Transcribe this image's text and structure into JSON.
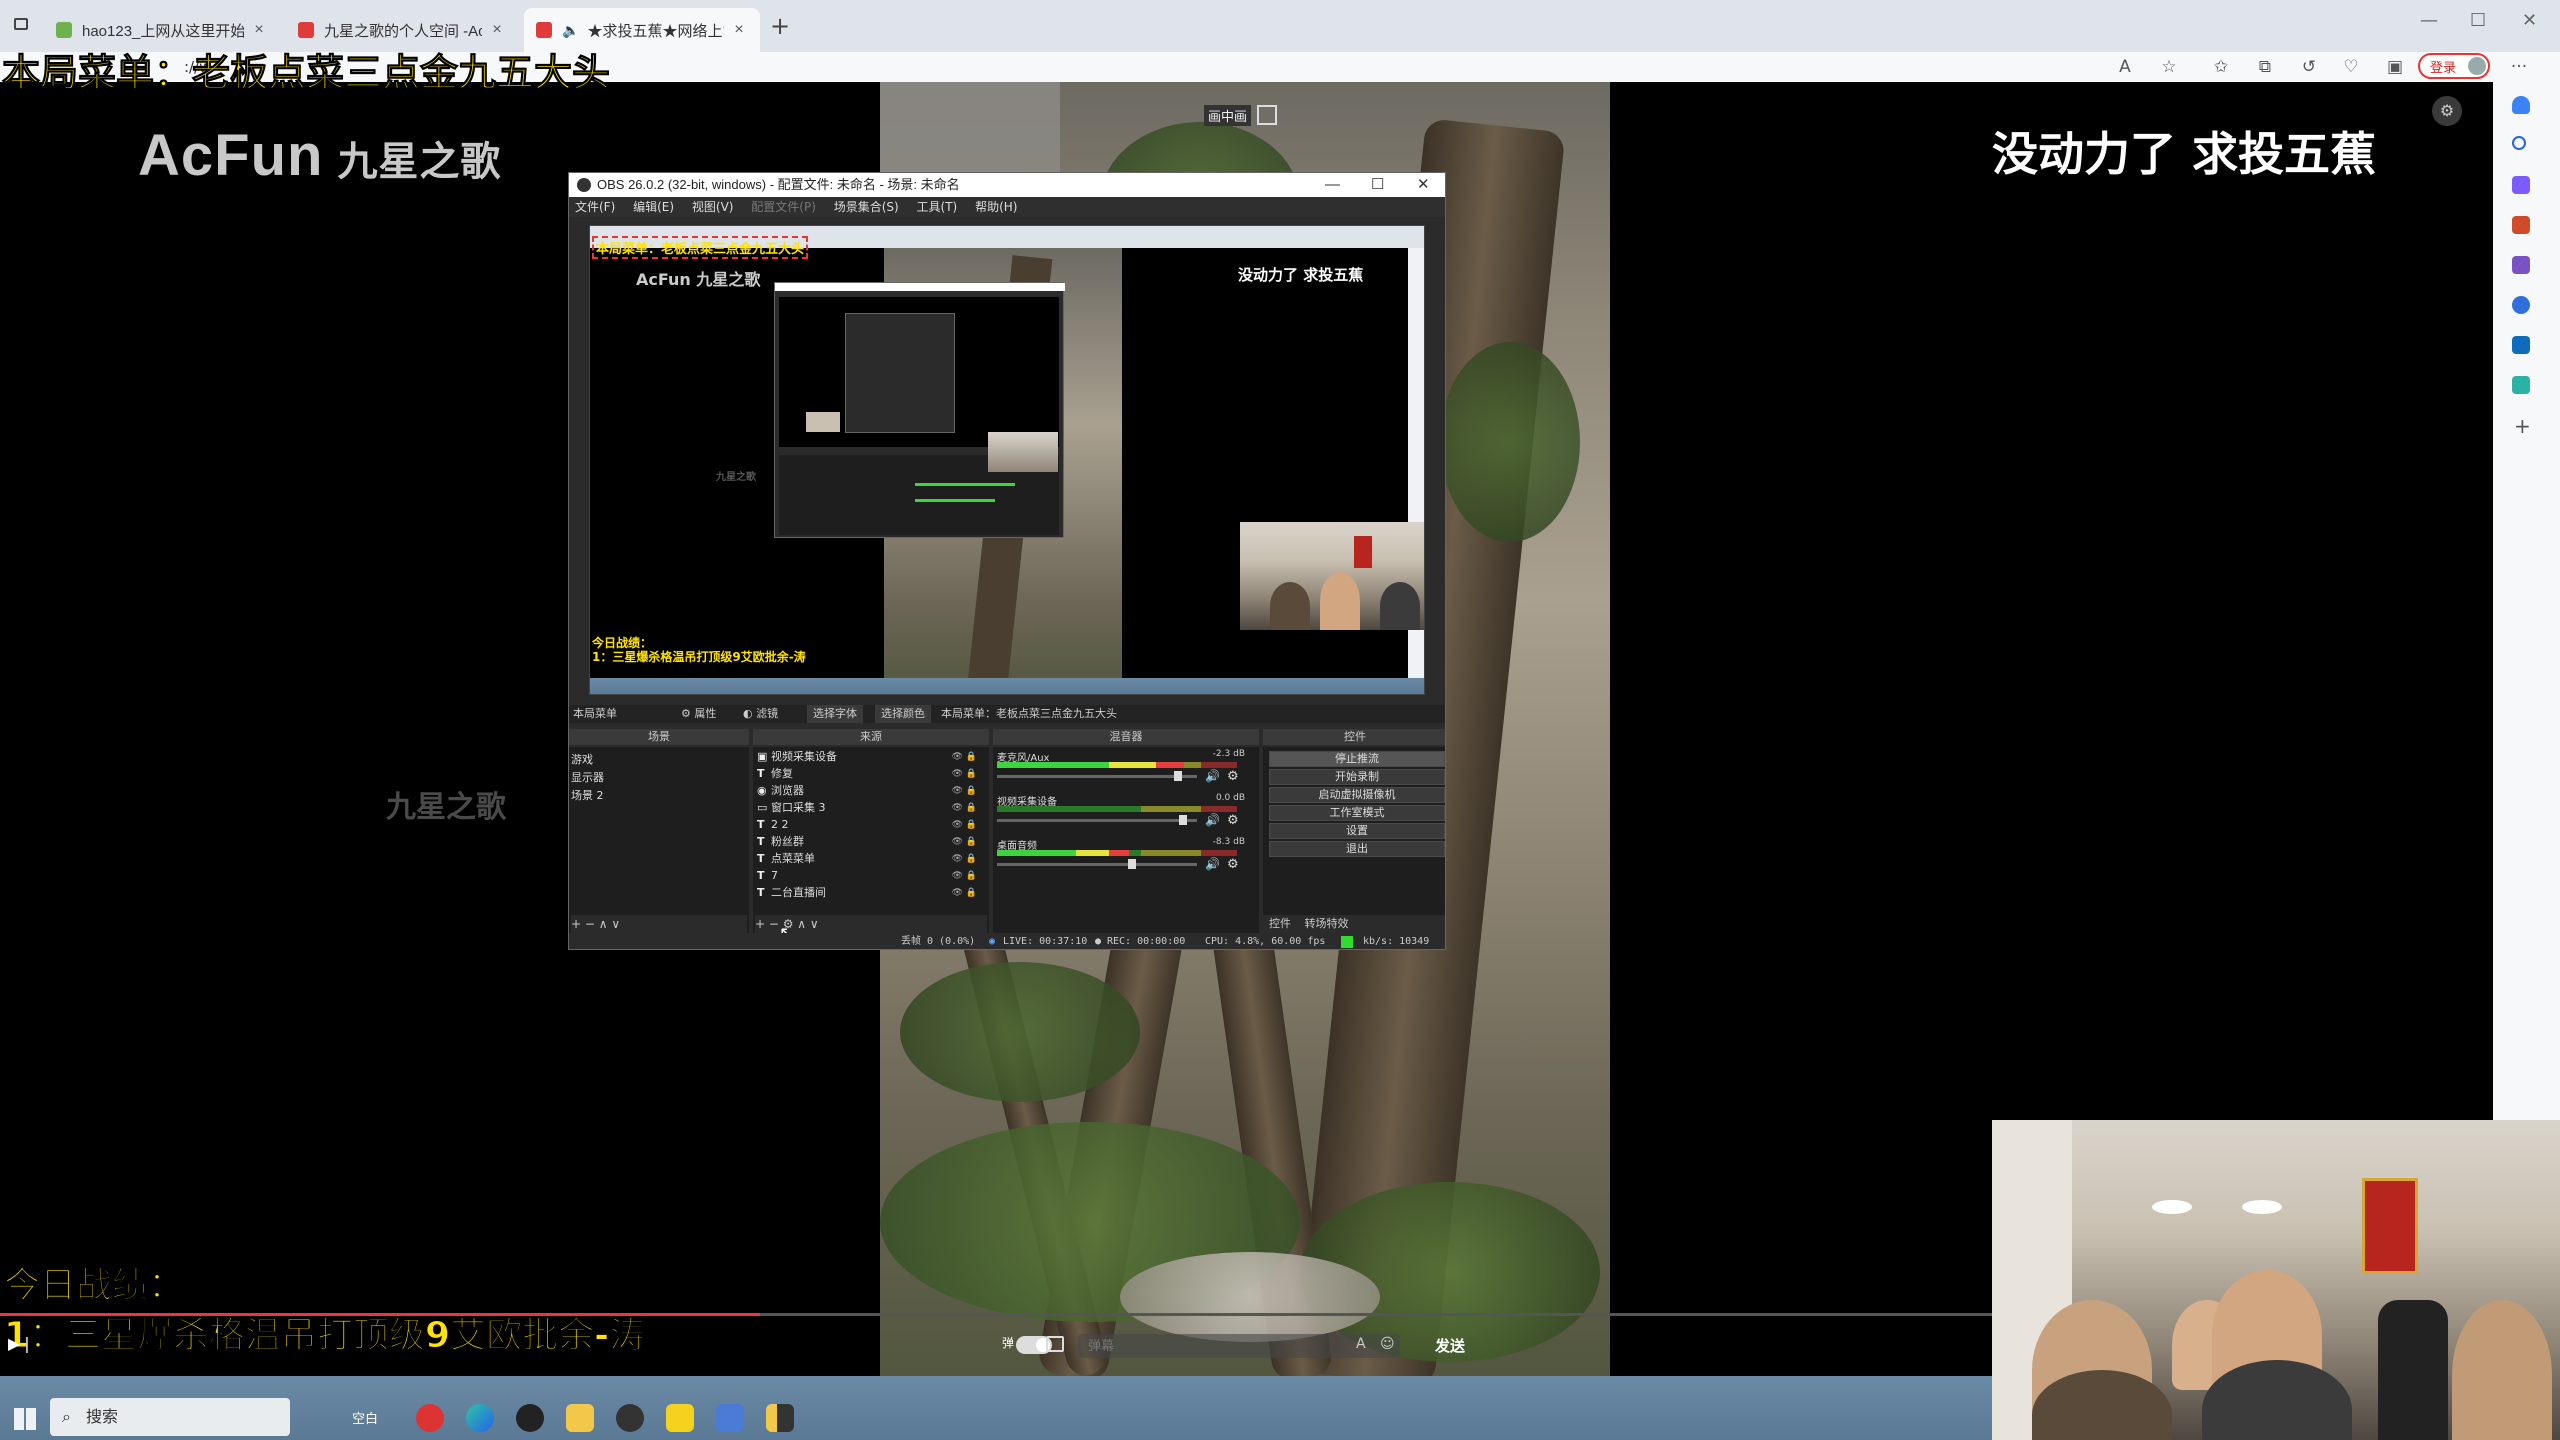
{
  "browser": {
    "tabs": [
      {
        "title": "hao123_上网从这里开始",
        "close": "×"
      },
      {
        "title": "九星之歌的个人空间 -AcFun弹幕",
        "close": "×"
      },
      {
        "title": "★求投五蕉★网络上常见的",
        "close": "×"
      }
    ],
    "new_tab": "+",
    "address_partial": "://w",
    "login_label": "登录",
    "window_controls": {
      "minimize": "—",
      "maximize": "☐",
      "close": "✕"
    },
    "more": "···"
  },
  "stream": {
    "menu_overlay": "本局菜单：老板点菜三点金九五大头",
    "logo_text": "AcFun",
    "logo_cn": "九星之歌",
    "watermark": "九星之歌",
    "slogan": "没动力了 求投五蕉",
    "today_title": "今日战绩：",
    "today_item": "1：三星爆杀格温吊打顶级9艾欧批余-涛",
    "pip_label": "画中画"
  },
  "obs": {
    "title": "OBS 26.0.2 (32-bit, windows) - 配置文件: 未命名 - 场景: 未命名",
    "menu": [
      "文件(F)",
      "编辑(E)",
      "视图(V)",
      "配置文件(P)",
      "场景集合(S)",
      "工具(T)",
      "帮助(H)"
    ],
    "current_source": "本局菜单",
    "props_btn": "属性",
    "filters_btn": "滤镜",
    "font_btn": "选择字体",
    "color_btn": "选择颜色",
    "text_value": "本局菜单：老板点菜三点金九五大头",
    "docks": {
      "scenes_title": "场景",
      "sources_title": "来源",
      "mixer_title": "混音器",
      "controls_title": "控件"
    },
    "scenes": [
      "游戏",
      "显示器",
      "场景 2"
    ],
    "sources": [
      {
        "icon": "▣",
        "name": "视频采集设备"
      },
      {
        "icon": "T",
        "name": "修复"
      },
      {
        "icon": "◉",
        "name": "浏览器"
      },
      {
        "icon": "▭",
        "name": "窗口采集 3"
      },
      {
        "icon": "T",
        "name": "2 2"
      },
      {
        "icon": "T",
        "name": "粉丝群"
      },
      {
        "icon": "T",
        "name": "点菜菜单"
      },
      {
        "icon": "T",
        "name": "7"
      },
      {
        "icon": "T",
        "name": "二台直播间"
      }
    ],
    "mixer": [
      {
        "name": "麦克风/Aux",
        "db": "-2.3 dB",
        "level": 0.78,
        "volume": 0.92
      },
      {
        "name": "视频采集设备",
        "db": "0.0 dB",
        "level": 0.0,
        "volume": 0.95
      },
      {
        "name": "桌面音频",
        "db": "-8.3 dB",
        "level": 0.55,
        "volume": 0.68
      }
    ],
    "controls": [
      "停止推流",
      "开始录制",
      "启动虚拟摄像机",
      "工作室模式",
      "设置",
      "退出"
    ],
    "controls_tabs": [
      "控件",
      "转场特效"
    ],
    "dock_foot_scenes": "+ − ∧ ∨",
    "dock_foot_sources": "+ − ⚙ ∧ ∨",
    "status": {
      "dropped": "丢帧 0 (0.0%)",
      "live": "LIVE: 00:37:10",
      "rec": "REC: 00:00:00",
      "cpu": "CPU: 4.8%, 60.00 fps",
      "kbps": "kb/s: 10349"
    },
    "nested": {
      "menu_overlay": "本局菜单：老板点菜三点金九五大头",
      "logo": "AcFun 九星之歌",
      "slogan": "没动力了 求投五蕉",
      "watermark": "九星之歌",
      "today_title": "今日战绩：",
      "today_item": "1：三星爆杀格温吊打顶级9艾欧批余-涛"
    }
  },
  "player": {
    "danmu_label": "弹",
    "send_label": "发送",
    "input_placeholder": "弹幕"
  },
  "taskbar": {
    "search_placeholder": "搜索",
    "weather": "空白"
  },
  "colors": {
    "overlay_yellow": "#ffe200",
    "obs_bg": "#2b2b2b",
    "login_red": "#e33333"
  }
}
